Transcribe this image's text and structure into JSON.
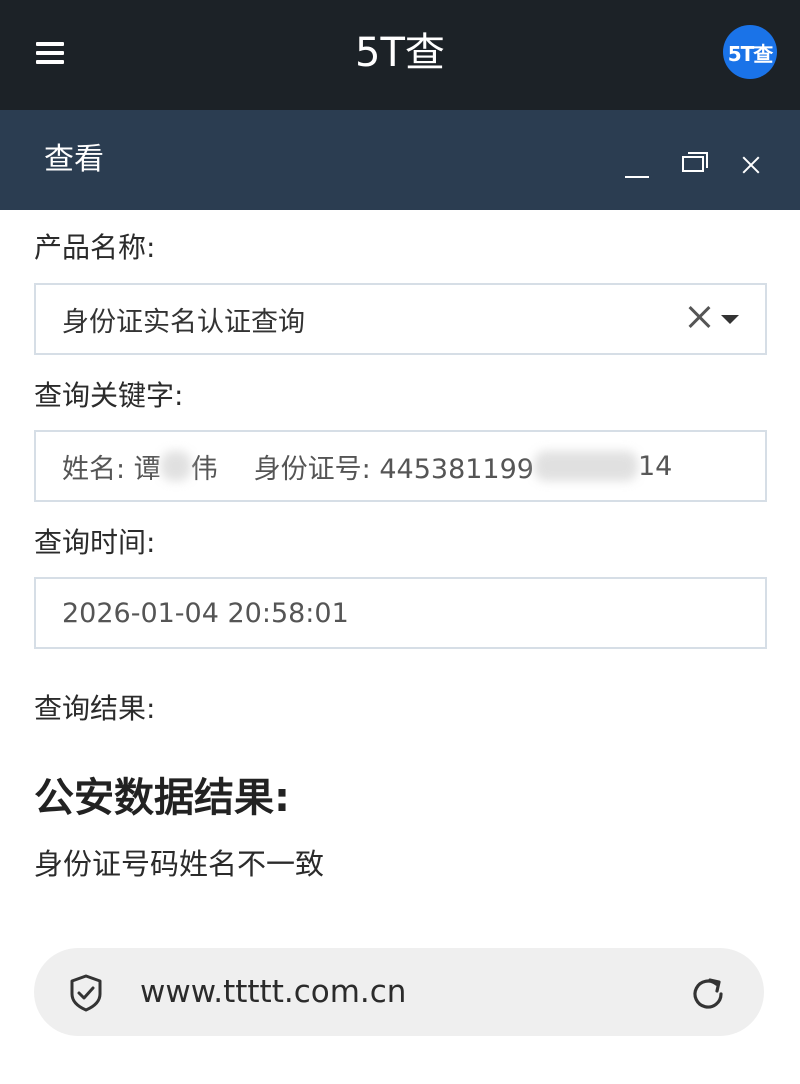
{
  "topbar": {
    "title": "5T查",
    "avatar_text": "5T查",
    "menu_icon": "hamburger-menu-icon"
  },
  "dialog": {
    "title": "查看",
    "buttons": [
      "minimize-icon",
      "maximize-icon",
      "close-icon"
    ]
  },
  "form": {
    "product_label": "产品名称:",
    "product_value": "身份证实名认证查询",
    "keyword_label": "查询关键字:",
    "keyword": {
      "name_prefix": "姓名: 谭",
      "name_suffix": "伟",
      "id_prefix": "身份证号: 445381199",
      "id_suffix": "14"
    },
    "time_label": "查询时间:",
    "time_value": "2026-01-04 20:58:01",
    "result_label": "查询结果:"
  },
  "result": {
    "heading": "公安数据结果:",
    "text": "身份证号码姓名不一致"
  },
  "browser": {
    "url": "www.ttttt.com.cn",
    "left_icon": "shield-check-icon",
    "right_icon": "reload-icon"
  },
  "colors": {
    "topbar_bg": "#1c2227",
    "dialog_header_bg": "#2b3d51",
    "avatar_bg": "#1a73e8"
  }
}
